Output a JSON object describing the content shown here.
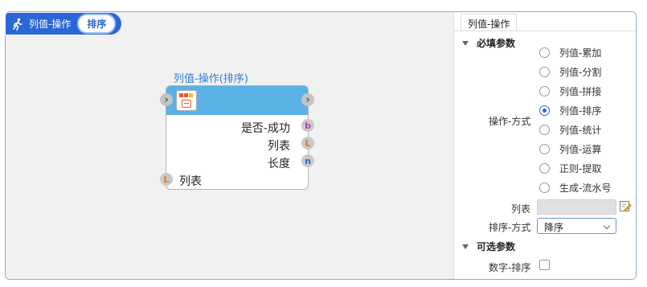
{
  "header": {
    "title": "列值-操作",
    "badge": "排序",
    "icon": "running-person-icon"
  },
  "node": {
    "title": "列值-操作(排序)",
    "outputs": [
      {
        "label": "是否-成功",
        "type": "b",
        "color": "#b142b8"
      },
      {
        "label": "列表",
        "type": "L",
        "color": "#e07b1f"
      },
      {
        "label": "长度",
        "type": "n",
        "color": "#2b66d6"
      }
    ],
    "inputs": [
      {
        "label": "列表",
        "type": "L",
        "color": "#e07b1f"
      }
    ]
  },
  "panel": {
    "tab": "列值-操作",
    "required_section": "必填参数",
    "optional_section": "可选参数",
    "operation_label": "操作-方式",
    "operations": [
      {
        "label": "列值-累加",
        "selected": false
      },
      {
        "label": "列值-分割",
        "selected": false
      },
      {
        "label": "列值-拼接",
        "selected": false
      },
      {
        "label": "列值-排序",
        "selected": true
      },
      {
        "label": "列值-统计",
        "selected": false
      },
      {
        "label": "列值-运算",
        "selected": false
      },
      {
        "label": "正则-提取",
        "selected": false
      },
      {
        "label": "生成-流水号",
        "selected": false
      }
    ],
    "list_label": "列表",
    "list_value": "",
    "sort_label": "排序-方式",
    "sort_value": "降序",
    "numeric_sort_label": "数字-排序",
    "numeric_sort_checked": false
  }
}
